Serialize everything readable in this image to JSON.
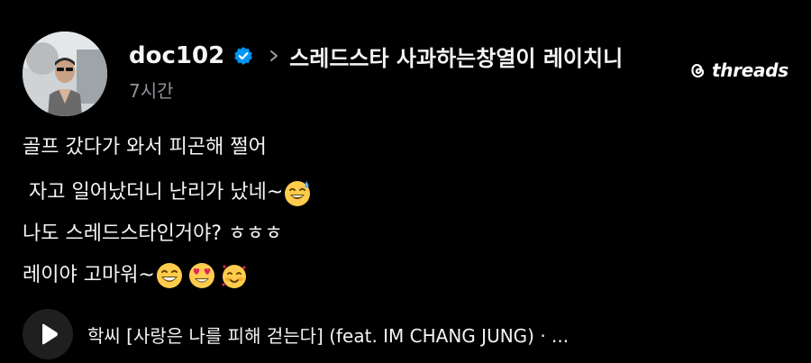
{
  "header": {
    "username": "doc102",
    "community": "스레드스타 사과하는창열이 레이치니",
    "time": "7시간"
  },
  "brand": {
    "name": "threads"
  },
  "post": {
    "lines": [
      "골프 갔다가 와서 피곤해 쩔어",
      " 자고 일어났더니 난리가 났네~",
      "나도 스레드스타인거야? ㅎㅎㅎ",
      "레이야 고마워~"
    ]
  },
  "music": {
    "title": "학씨 [사랑은 나를 피해 걷는다] (feat. IM CHANG JUNG) · ..."
  },
  "icons": {
    "verified": "verified-badge-icon",
    "chevron": "chevron-right-icon",
    "brand": "threads-logo-icon",
    "play": "play-icon",
    "emoji1": "grinning-sweat-emoji",
    "emoji2": "grinning-emoji",
    "emoji3": "heart-eyes-emoji",
    "emoji4": "smiling-hearts-emoji"
  },
  "colors": {
    "background": "#000000",
    "text": "#f3f5f7",
    "muted": "#8f949a",
    "verified": "#0095f6",
    "emoji": "#ffcc4d"
  }
}
